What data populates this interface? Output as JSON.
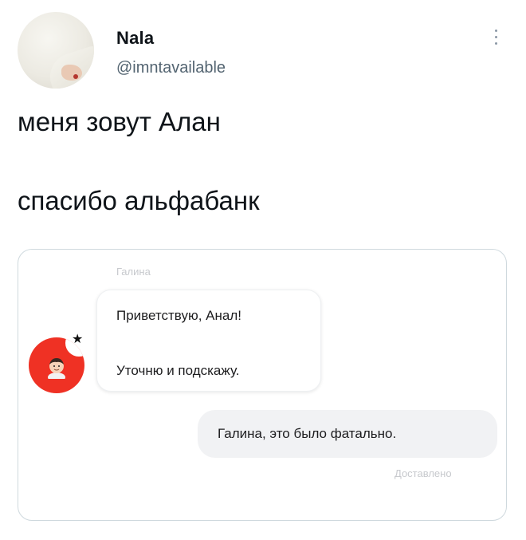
{
  "tweet": {
    "author_name": "Nala",
    "author_handle": "@imntavailable",
    "lines": [
      "меня зовут Алан",
      "спасибо альфабанк"
    ]
  },
  "chat": {
    "sender_name": "Галина",
    "incoming": [
      "Приветствую, Анал!",
      "Уточню и подскажу."
    ],
    "outgoing": "Галина, это было фатально.",
    "status": "Доставлено",
    "bot_badge": "★",
    "brand_color": "#ef3124"
  },
  "icons": {
    "more": "more-vertical-icon"
  }
}
